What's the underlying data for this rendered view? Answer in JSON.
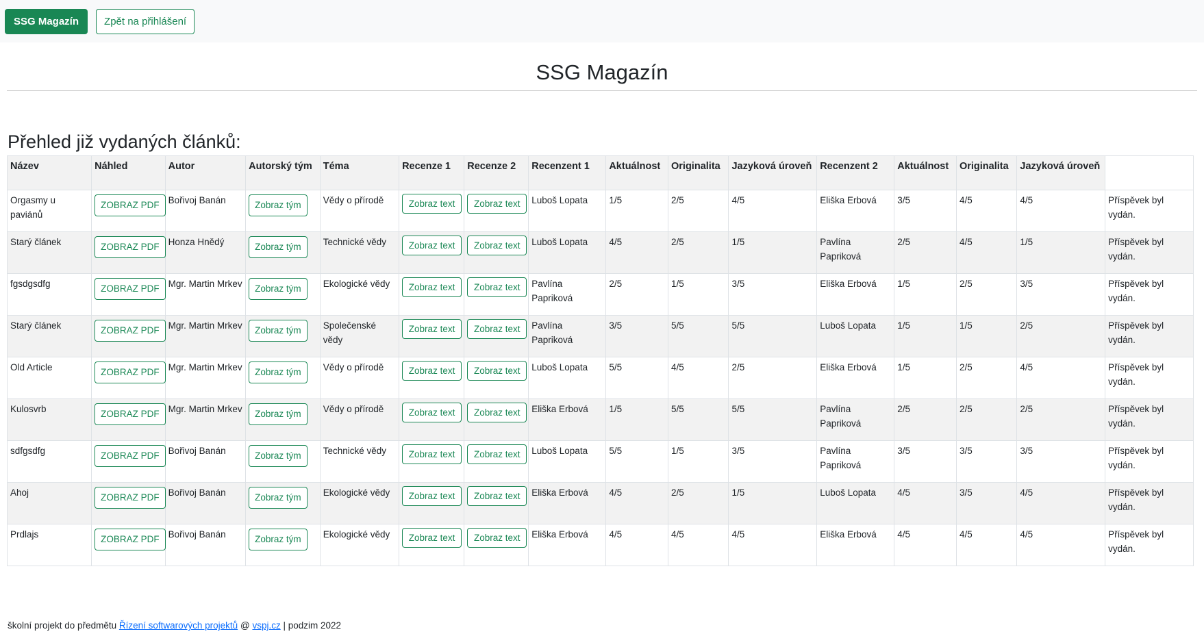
{
  "navbar": {
    "brand_label": "SSG Magazín",
    "back_label": "Zpět na přihlášení"
  },
  "page_title": "SSG Magazín",
  "section_heading": "Přehled již vydaných článků:",
  "table": {
    "headers": [
      "Název",
      "Náhled",
      "Autor",
      "Autorský tým",
      "Téma",
      "Recenze 1",
      "Recenze 2",
      "Recenzent 1",
      "Aktuálnost",
      "Originalita",
      "Jazyková úroveň",
      "Recenzent 2",
      "Aktuálnost",
      "Originalita",
      "Jazyková úroveň"
    ],
    "pdf_button_label": "ZOBRAZ PDF",
    "team_button_label": "Zobraz tým",
    "text_button_label": "Zobraz text",
    "status_text": "Příspěvek byl vydán.",
    "rows": [
      {
        "name": "Orgasmy u paviánů",
        "author": "Bořivoj Banán",
        "topic": "Vědy o přírodě",
        "reviewer1": "Luboš Lopata",
        "r1_aktualnost": "1/5",
        "r1_originalita": "2/5",
        "r1_jazyk": "4/5",
        "reviewer2": "Eliška Erbová",
        "r2_aktualnost": "3/5",
        "r2_originalita": "4/5",
        "r2_jazyk": "4/5"
      },
      {
        "name": "Starý článek",
        "author": "Honza Hnědý",
        "topic": "Technické vědy",
        "reviewer1": "Luboš Lopata",
        "r1_aktualnost": "4/5",
        "r1_originalita": "2/5",
        "r1_jazyk": "1/5",
        "reviewer2": "Pavlína Papriková",
        "r2_aktualnost": "2/5",
        "r2_originalita": "4/5",
        "r2_jazyk": "1/5"
      },
      {
        "name": "fgsdgsdfg",
        "author": "Mgr. Martin Mrkev",
        "topic": "Ekologické vědy",
        "reviewer1": "Pavlína Papriková",
        "r1_aktualnost": "2/5",
        "r1_originalita": "1/5",
        "r1_jazyk": "3/5",
        "reviewer2": "Eliška Erbová",
        "r2_aktualnost": "1/5",
        "r2_originalita": "2/5",
        "r2_jazyk": "3/5"
      },
      {
        "name": "Starý článek",
        "author": "Mgr. Martin Mrkev",
        "topic": "Společenské vědy",
        "reviewer1": "Pavlína Papriková",
        "r1_aktualnost": "3/5",
        "r1_originalita": "5/5",
        "r1_jazyk": "5/5",
        "reviewer2": "Luboš Lopata",
        "r2_aktualnost": "1/5",
        "r2_originalita": "1/5",
        "r2_jazyk": "2/5"
      },
      {
        "name": "Old Article",
        "author": "Mgr. Martin Mrkev",
        "topic": "Vědy o přírodě",
        "reviewer1": "Luboš Lopata",
        "r1_aktualnost": "5/5",
        "r1_originalita": "4/5",
        "r1_jazyk": "2/5",
        "reviewer2": "Eliška Erbová",
        "r2_aktualnost": "1/5",
        "r2_originalita": "2/5",
        "r2_jazyk": "4/5"
      },
      {
        "name": "Kulosvrb",
        "author": "Mgr. Martin Mrkev",
        "topic": "Vědy o přírodě",
        "reviewer1": "Eliška Erbová",
        "r1_aktualnost": "1/5",
        "r1_originalita": "5/5",
        "r1_jazyk": "5/5",
        "reviewer2": "Pavlína Papriková",
        "r2_aktualnost": "2/5",
        "r2_originalita": "2/5",
        "r2_jazyk": "2/5"
      },
      {
        "name": "sdfgsdfg",
        "author": "Bořivoj Banán",
        "topic": "Technické vědy",
        "reviewer1": "Luboš Lopata",
        "r1_aktualnost": "5/5",
        "r1_originalita": "1/5",
        "r1_jazyk": "3/5",
        "reviewer2": "Pavlína Papriková",
        "r2_aktualnost": "3/5",
        "r2_originalita": "3/5",
        "r2_jazyk": "3/5"
      },
      {
        "name": "Ahoj",
        "author": "Bořivoj Banán",
        "topic": "Ekologické vědy",
        "reviewer1": "Eliška Erbová",
        "r1_aktualnost": "4/5",
        "r1_originalita": "2/5",
        "r1_jazyk": "1/5",
        "reviewer2": "Luboš Lopata",
        "r2_aktualnost": "4/5",
        "r2_originalita": "3/5",
        "r2_jazyk": "4/5"
      },
      {
        "name": "Prdlajs",
        "author": "Bořivoj Banán",
        "topic": "Ekologické vědy",
        "reviewer1": "Eliška Erbová",
        "r1_aktualnost": "4/5",
        "r1_originalita": "4/5",
        "r1_jazyk": "4/5",
        "reviewer2": "Eliška Erbová",
        "r2_aktualnost": "4/5",
        "r2_originalita": "4/5",
        "r2_jazyk": "4/5"
      }
    ]
  },
  "footer": {
    "prefix": "školní projekt do předmětu",
    "course_link": "Řízení softwarových projektů",
    "at": "@",
    "school_link": "vspj.cz",
    "suffix": "| podzim 2022"
  },
  "colors": {
    "accent": "#198754",
    "stripe": "#f2f2f2",
    "navbar_bg": "#f8f9fa",
    "link": "#0d6efd"
  }
}
